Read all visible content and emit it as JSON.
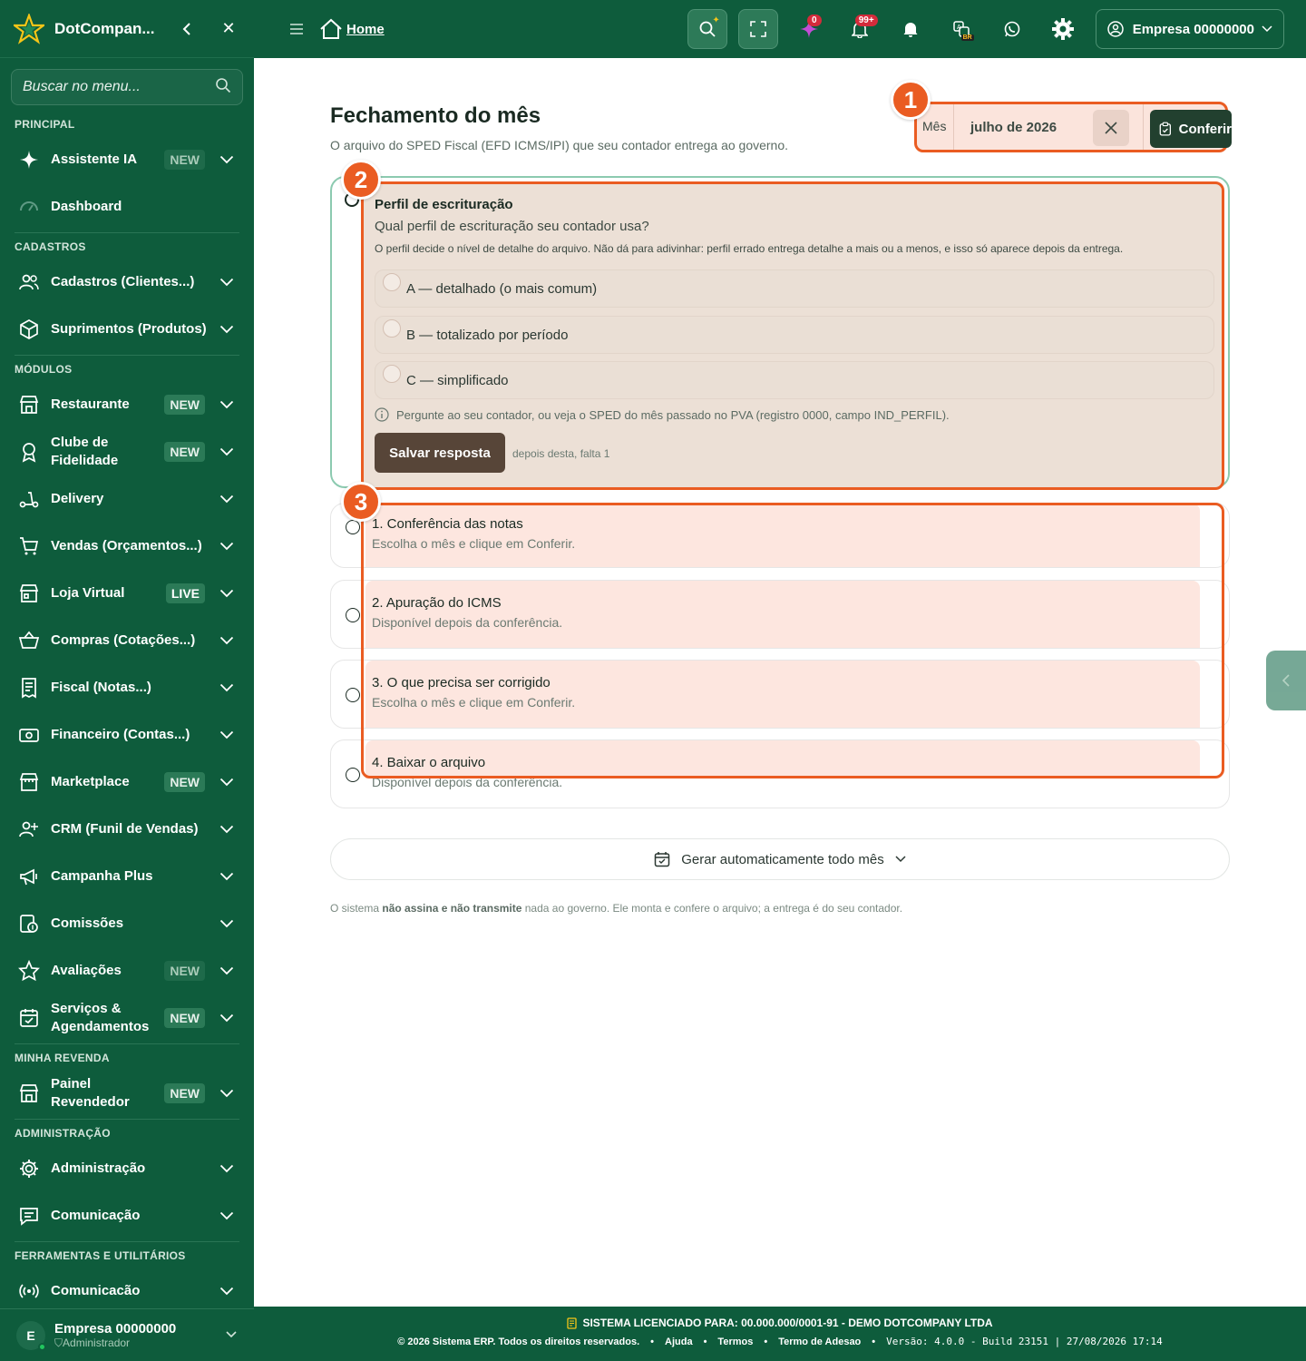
{
  "sidebar": {
    "brand": "DotCompan...",
    "search_placeholder": "Buscar no menu...",
    "sections": [
      {
        "title": "PRINCIPAL",
        "items": [
          {
            "label": "Assistente IA",
            "badge": "NEW",
            "icon": "sparkle-icon"
          },
          {
            "label": "Dashboard",
            "icon": "gauge-icon"
          }
        ]
      },
      {
        "title": "CADASTROS",
        "items": [
          {
            "label": "Cadastros (Clientes...)",
            "icon": "users-icon"
          },
          {
            "label": "Suprimentos (Produtos)",
            "icon": "box-icon"
          }
        ]
      },
      {
        "title": "MÓDULOS",
        "items": [
          {
            "label": "Restaurante",
            "badge": "NEW",
            "icon": "store-icon"
          },
          {
            "label": "Clube de Fidelidade",
            "badge": "NEW",
            "icon": "medal-icon"
          },
          {
            "label": "Delivery",
            "icon": "scooter-icon"
          },
          {
            "label": "Vendas (Orçamentos...)",
            "icon": "cart-icon"
          },
          {
            "label": "Loja Virtual",
            "badge": "LIVE",
            "icon": "shop-icon"
          },
          {
            "label": "Compras (Cotações...)",
            "icon": "basket-icon"
          },
          {
            "label": "Fiscal (Notas...)",
            "icon": "receipt-icon"
          },
          {
            "label": "Financeiro (Contas...)",
            "icon": "money-icon"
          },
          {
            "label": "Marketplace",
            "badge": "NEW",
            "icon": "market-icon"
          },
          {
            "label": "CRM (Funil de Vendas)",
            "icon": "crm-icon"
          },
          {
            "label": "Campanha Plus",
            "icon": "megaphone-icon"
          },
          {
            "label": "Comissões",
            "icon": "commission-icon"
          },
          {
            "label": "Avaliações",
            "badge": "NEW",
            "icon": "star-icon"
          },
          {
            "label": "Serviços & Agendamentos",
            "badge": "NEW",
            "icon": "calendar-icon"
          }
        ]
      },
      {
        "title": "MINHA REVENDA",
        "items": [
          {
            "label": "Painel Revendedor",
            "badge": "NEW",
            "icon": "store-icon"
          }
        ]
      },
      {
        "title": "ADMINISTRAÇÃO",
        "items": [
          {
            "label": "Administração",
            "icon": "gear-icon"
          },
          {
            "label": "Comunicação",
            "icon": "chat-icon"
          }
        ]
      },
      {
        "title": "FERRAMENTAS E UTILITÁRIOS",
        "items": [
          {
            "label": "Comunicacão",
            "icon": "broadcast-icon"
          }
        ]
      }
    ],
    "user": {
      "initial": "E",
      "name": "Empresa 00000000",
      "role": "Administrador"
    }
  },
  "topbar": {
    "home": "Home",
    "sparkle_count": "0",
    "bell_count": "99+",
    "lang_badge": "BR",
    "account": "Empresa 00000000"
  },
  "main": {
    "title": "Fechamento do mês",
    "subtitle": "O arquivo do SPED Fiscal (EFD ICMS/IPI) que seu contador entrega ao governo.",
    "month_label": "Mês",
    "month_value": "julho de 2026",
    "check_label": "Conferir",
    "profile": {
      "title": "Perfil de escrituração",
      "question": "Qual perfil de escrituração seu contador usa?",
      "description": "O perfil decide o nível de detalhe do arquivo. Não dá para adivinhar: perfil errado entrega detalhe a mais ou a menos, e isso só aparece depois da entrega.",
      "options": [
        "A — detalhado (o mais comum)",
        "B — totalizado por período",
        "C — simplificado"
      ],
      "hint": "Pergunte ao seu contador, ou veja o SPED do mês passado no PVA (registro 0000, campo IND_PERFIL).",
      "save_label": "Salvar resposta",
      "remaining": "depois desta, falta 1"
    },
    "steps": [
      {
        "title": "1. Conferência das notas",
        "subtitle": "Escolha o mês e clique em Conferir."
      },
      {
        "title": "2. Apuração do ICMS",
        "subtitle": "Disponível depois da conferência."
      },
      {
        "title": "3. O que precisa ser corrigido",
        "subtitle": "Escolha o mês e clique em Conferir."
      },
      {
        "title": "4. Baixar o arquivo",
        "subtitle": "Disponível depois da conferência."
      }
    ],
    "auto_generate": "Gerar automaticamente todo mês",
    "disclaimer_pre": "O sistema ",
    "disclaimer_bold": "não assina e não transmite",
    "disclaimer_post": " nada ao governo. Ele monta e confere o arquivo; a entrega é do seu contador.",
    "annotations": [
      "1",
      "2",
      "3"
    ]
  },
  "footer": {
    "license": "SISTEMA LICENCIADO PARA: 00.000.000/0001-91 - DEMO DOTCOMPANY LTDA",
    "copyright": "© 2026 Sistema ERP. Todos os direitos reservados.",
    "links": [
      "Ajuda",
      "Termos",
      "Termo de Adesao"
    ],
    "version": "Versão: 4.0.0 - Build 23151 | 27/08/2026 17:14"
  },
  "colors": {
    "brand": "#0e5c3c",
    "accent": "#ea5c22",
    "highlight": "#fde6df"
  }
}
